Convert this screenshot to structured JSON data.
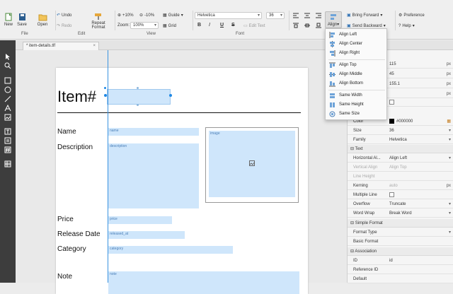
{
  "toolbar": {
    "new": "New",
    "save": "Save",
    "open": "Open",
    "undo": "Undo",
    "redo": "Redo",
    "repeat_format": "Repeat Format",
    "zoom_in": "+10%",
    "zoom_out": "-10%",
    "zoom_label": "Zoom:",
    "zoom_value": "100%",
    "guide": "Guide",
    "grid": "Grid",
    "font_family": "Helvetica",
    "font_size": "36",
    "bold": "B",
    "italic": "I",
    "underline": "U",
    "strike": "S",
    "edit_text": "Edit Text",
    "align": "Align",
    "bring_forward": "Bring Forward",
    "send_backward": "Send Backward",
    "preference": "Preference",
    "help": "Help",
    "groups": {
      "file": "File",
      "edit": "Edit",
      "view": "View",
      "font": "Font"
    }
  },
  "tab": {
    "title": "* item-details.tlf",
    "close": "×"
  },
  "align_menu": {
    "items": [
      "Align Left",
      "Align Center",
      "Align Right",
      "Align Top",
      "Align Middle",
      "Align Bottom",
      "Same Width",
      "Same Height",
      "Same Size"
    ]
  },
  "page": {
    "title": "Item#",
    "labels": {
      "name": "Name",
      "description": "Description",
      "price": "Price",
      "release": "Release Date",
      "category": "Category",
      "note": "Note"
    },
    "fields": {
      "name": "name",
      "description": "description",
      "image": "image",
      "price": "price",
      "released": "released_at",
      "category": "category",
      "note": "note"
    }
  },
  "panel": {
    "geom": [
      {
        "value": "115",
        "unit": "px"
      },
      {
        "value": "45",
        "unit": "px"
      },
      {
        "value": "155.1",
        "unit": "px"
      },
      {
        "value": "",
        "unit": "px"
      }
    ],
    "color_label": "Color",
    "color_value": "#000000",
    "size_label": "Size",
    "size_value": "36",
    "family_label": "Family",
    "family_value": "Helvetica",
    "text_section": "Text",
    "halign_label": "Horizontal Al...",
    "halign_value": "Align Left",
    "valign_label": "Vertical Align",
    "valign_value": "Align Top",
    "lineheight_label": "Line Height",
    "kerning_label": "Kerning",
    "kerning_value": "auto",
    "kerning_unit": "px",
    "multiple_label": "Multiple Line",
    "overflow_label": "Overflow",
    "overflow_value": "Truncate",
    "wordwrap_label": "Word Wrap",
    "wordwrap_value": "Break Word",
    "simple_section": "Simple Format",
    "formattype_label": "Format Type",
    "basicformat_label": "Basic Format",
    "assoc_section": "Association",
    "id_label": "ID",
    "id_value": "id",
    "refid_label": "Reference ID",
    "default_label": "Default"
  },
  "colors": {
    "field_fill": "#cfe6fb",
    "selection": "#1e88e5",
    "toolbar_dark": "#3d3d3d"
  }
}
